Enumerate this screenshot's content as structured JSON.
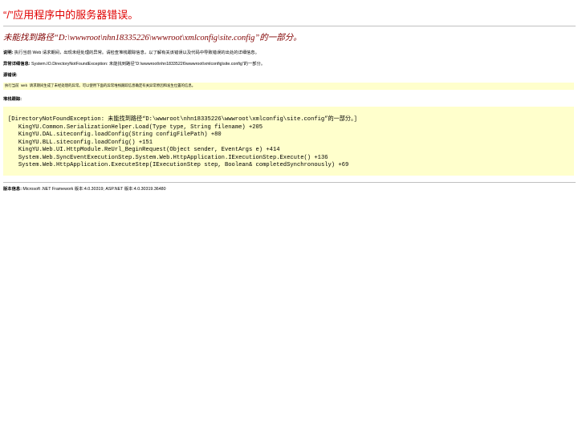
{
  "page": {
    "title": "“/”应用程序中的服务器错误。",
    "error_message": "未能找到路径“D:\\wwwroot\\nhn18335226\\wwwroot\\xmlconfig\\site.config”的一部分。"
  },
  "description": {
    "label": "说明:",
    "text": " 执行当前 Web 请求期间，出现未经处理的异常。请检查堆栈跟踪信息，以了解有关该错误以及代码中导致错误的出处的详细信息。"
  },
  "exception_details": {
    "label": "异常详细信息:",
    "text": " System.IO.DirectoryNotFoundException: 未能找到路径“D:\\wwwroot\\nhn18335226\\wwwroot\\xmlconfig\\site.config”的一部分。"
  },
  "source_error": {
    "label": "源错误:",
    "text": "执行当前 Web 请求期间生成了未经处理的异常。可以使用下面的异常堆栈跟踪信息确定有关异常原因和发生位置的信息。"
  },
  "stack_trace": {
    "label": "堆栈跟踪:",
    "lines": [
      "[DirectoryNotFoundException: 未能找到路径“D:\\wwwroot\\nhn18335226\\wwwroot\\xmlconfig\\site.config”的一部分。]",
      "   KingYU.Common.SerializationHelper.Load(Type type, String filename) +205",
      "   KingYU.DAL.siteconfig.loadConfig(String configFilePath) +80",
      "   KingYU.BLL.siteconfig.loadConfig() +151",
      "   KingYU.Web.UI.HttpModule.ReUrl_BeginRequest(Object sender, EventArgs e) +414",
      "   System.Web.SyncEventExecutionStep.System.Web.HttpApplication.IExecutionStep.Execute() +136",
      "   System.Web.HttpApplication.ExecuteStep(IExecutionStep step, Boolean& completedSynchronously) +69"
    ]
  },
  "version_info": {
    "label": "版本信息:",
    "text": " Microsoft .NET Framework 版本:4.0.30319; ASP.NET 版本:4.0.30319.36480"
  },
  "colors": {
    "title": "#e00000",
    "error_message": "#800000",
    "code_background": "#ffffcc",
    "rule": "#c0c0c0"
  }
}
